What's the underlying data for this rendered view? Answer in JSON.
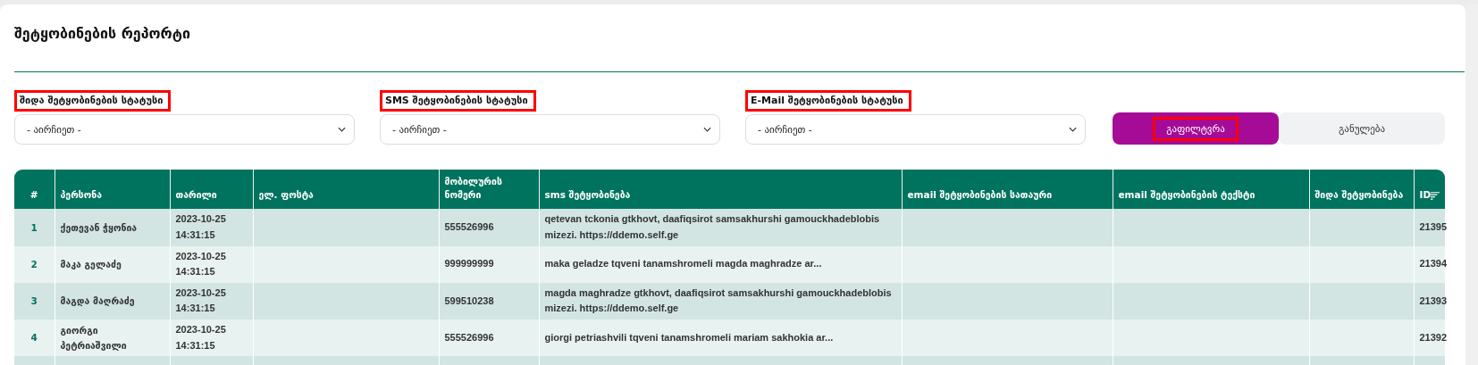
{
  "page": {
    "title": "შეტყობინების რეპორტი"
  },
  "filters": [
    {
      "label": "შიდა შეტყობინების სტატუსი",
      "highlighted": true,
      "placeholder": "- აირჩიეთ -"
    },
    {
      "label": "SMS შეტყობინების სტატუსი",
      "highlighted": true,
      "placeholder": "- აირჩიეთ -"
    },
    {
      "label": "E-Mail შეტყობინების სტატუსი",
      "highlighted": true,
      "placeholder": "- აირჩიეთ -"
    }
  ],
  "buttons": [
    {
      "label": "გაფილტვრა",
      "kind": "primary",
      "highlighted": true
    },
    {
      "label": "განულება",
      "kind": "secondary",
      "highlighted": false
    }
  ],
  "table": {
    "columns": [
      {
        "label": "#",
        "sortable": false
      },
      {
        "label": "პერსონა",
        "sortable": false
      },
      {
        "label": "თარილი",
        "sortable": false
      },
      {
        "label": "ელ. ფოსტა",
        "sortable": false
      },
      {
        "label": "მობილურის ნომერი",
        "sortable": false
      },
      {
        "label": "sms შეტყობინება",
        "sortable": false
      },
      {
        "label": "email შეტყობინების სათაური",
        "sortable": false
      },
      {
        "label": "email შეტყობინების ტექსტი",
        "sortable": false
      },
      {
        "label": "შიდა შეტყობინება",
        "sortable": false
      },
      {
        "label": "ID",
        "sortable": true
      }
    ],
    "rows": [
      [
        "1",
        "ქეთევან ჭყონია",
        "2023-10-25 14:31:15",
        "",
        "555526996",
        "qetevan tckonia gtkhovt, daafiqsirot samsakhurshi gamouckhadeblobis mizezi. https://ddemo.self.ge",
        "",
        "",
        "",
        "21395"
      ],
      [
        "2",
        "მაკა გელაძე",
        "2023-10-25 14:31:15",
        "",
        "999999999",
        "maka geladze tqveni tanamshromeli magda maghradze ar...",
        "",
        "",
        "",
        "21394"
      ],
      [
        "3",
        "მაგდა მაღრაძე",
        "2023-10-25 14:31:15",
        "",
        "599510238",
        "magda maghradze gtkhovt, daafiqsirot samsakhurshi gamouckhadeblobis mizezi. https://ddemo.self.ge",
        "",
        "",
        "",
        "21393"
      ],
      [
        "4",
        "გიორგი პეტრიაშვილი",
        "2023-10-25 14:31:15",
        "",
        "555526996",
        "giorgi petriashvili tqveni tanamshromeli mariam sakhokia ar...",
        "",
        "",
        "",
        "21392"
      ]
    ]
  }
}
